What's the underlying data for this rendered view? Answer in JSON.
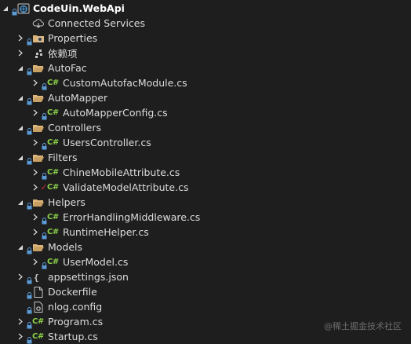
{
  "project": {
    "name": "CodeUin.WebApi"
  },
  "items": [
    {
      "depth": 1,
      "expander": "none",
      "lock": false,
      "icon": "connected-services",
      "label": "Connected Services",
      "name": "connected-services"
    },
    {
      "depth": 1,
      "expander": "collapsed",
      "lock": true,
      "icon": "properties",
      "label": "Properties",
      "name": "properties-folder"
    },
    {
      "depth": 1,
      "expander": "collapsed",
      "lock": false,
      "icon": "dependencies",
      "label": "依赖项",
      "name": "dependencies"
    },
    {
      "depth": 1,
      "expander": "expanded",
      "lock": true,
      "icon": "folder",
      "label": "AutoFac",
      "name": "autofac-folder"
    },
    {
      "depth": 2,
      "expander": "collapsed",
      "lock": true,
      "icon": "csharp",
      "label": "CustomAutofacModule.cs",
      "name": "custom-autofac-module-file"
    },
    {
      "depth": 1,
      "expander": "expanded",
      "lock": true,
      "icon": "folder",
      "label": "AutoMapper",
      "name": "automapper-folder"
    },
    {
      "depth": 2,
      "expander": "collapsed",
      "lock": true,
      "icon": "csharp",
      "label": "AutoMapperConfig.cs",
      "name": "automapper-config-file"
    },
    {
      "depth": 1,
      "expander": "expanded",
      "lock": true,
      "icon": "folder",
      "label": "Controllers",
      "name": "controllers-folder"
    },
    {
      "depth": 2,
      "expander": "collapsed",
      "lock": true,
      "icon": "csharp",
      "label": "UsersController.cs",
      "name": "users-controller-file"
    },
    {
      "depth": 1,
      "expander": "expanded",
      "lock": true,
      "icon": "folder",
      "label": "Filters",
      "name": "filters-folder"
    },
    {
      "depth": 2,
      "expander": "collapsed",
      "lock": true,
      "icon": "csharp",
      "label": "ChineMobileAttribute.cs",
      "name": "chine-mobile-attribute-file"
    },
    {
      "depth": 2,
      "expander": "collapsed",
      "lock": false,
      "check": true,
      "icon": "csharp",
      "label": "ValidateModelAttribute.cs",
      "name": "validate-model-attribute-file"
    },
    {
      "depth": 1,
      "expander": "expanded",
      "lock": true,
      "icon": "folder",
      "label": "Helpers",
      "name": "helpers-folder"
    },
    {
      "depth": 2,
      "expander": "collapsed",
      "lock": true,
      "icon": "csharp",
      "label": "ErrorHandlingMiddleware.cs",
      "name": "error-handling-middleware-file"
    },
    {
      "depth": 2,
      "expander": "collapsed",
      "lock": true,
      "icon": "csharp",
      "label": "RuntimeHelper.cs",
      "name": "runtime-helper-file"
    },
    {
      "depth": 1,
      "expander": "expanded",
      "lock": true,
      "icon": "folder",
      "label": "Models",
      "name": "models-folder"
    },
    {
      "depth": 2,
      "expander": "collapsed",
      "lock": true,
      "icon": "csharp",
      "label": "UserModel.cs",
      "name": "user-model-file"
    },
    {
      "depth": 1,
      "expander": "collapsed",
      "lock": true,
      "icon": "json",
      "label": "appsettings.json",
      "name": "appsettings-file"
    },
    {
      "depth": 1,
      "expander": "none",
      "lock": true,
      "icon": "file",
      "label": "Dockerfile",
      "name": "dockerfile-file"
    },
    {
      "depth": 1,
      "expander": "none",
      "lock": true,
      "icon": "config",
      "label": "nlog.config",
      "name": "nlog-config-file"
    },
    {
      "depth": 1,
      "expander": "collapsed",
      "lock": true,
      "icon": "csharp",
      "label": "Program.cs",
      "name": "program-file"
    },
    {
      "depth": 1,
      "expander": "collapsed",
      "lock": true,
      "icon": "csharp",
      "label": "Startup.cs",
      "name": "startup-file"
    }
  ],
  "watermark": "@稀土掘金技术社区",
  "colors": {
    "background": "#1e1e1e",
    "text": "#dcdcdc",
    "csharp": "#8ad04a",
    "folder": "#dcb67a",
    "lock": "#5b9bd5",
    "check": "#cc2f2f"
  }
}
